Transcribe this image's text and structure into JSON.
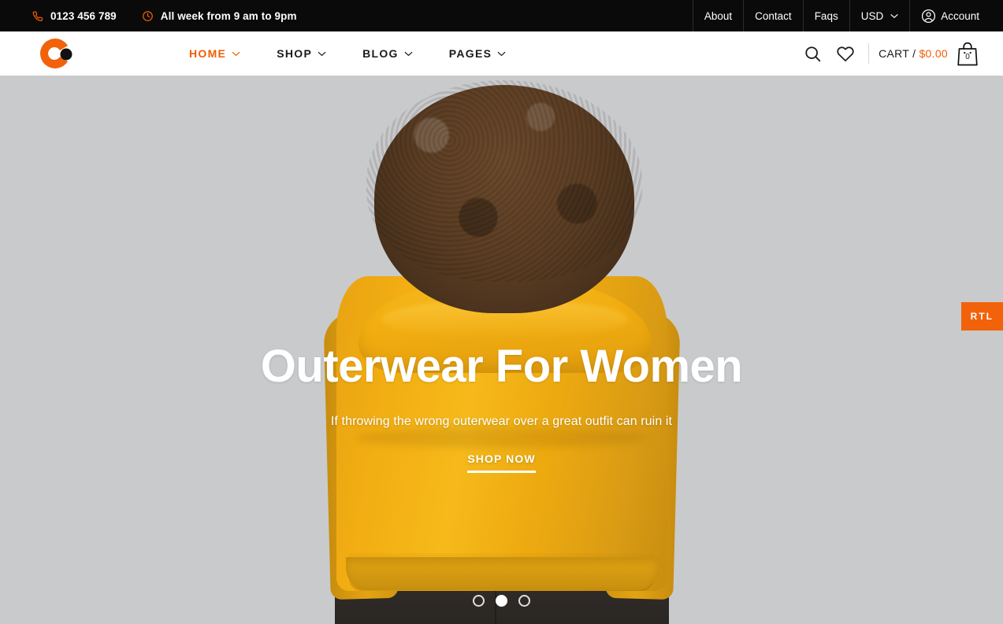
{
  "topbar": {
    "phone": "0123 456 789",
    "phone_icon": "phone-icon",
    "hours": "All week from 9 am to 9pm",
    "hours_icon": "clock-icon",
    "links": [
      "About",
      "Contact",
      "Faqs"
    ],
    "currency": "USD",
    "currency_chevron": "chevron-down-icon",
    "account": "Account",
    "account_icon": "user-circle-icon",
    "bg_color": "#0a0a0a",
    "accent_color": "#f25c05"
  },
  "nav": {
    "logo_name": "brand-logo",
    "menu": [
      {
        "label": "HOME",
        "active": true,
        "chevron": "chevron-down-icon"
      },
      {
        "label": "SHOP",
        "active": false,
        "chevron": "chevron-down-icon"
      },
      {
        "label": "BLOG",
        "active": false,
        "chevron": "chevron-down-icon"
      },
      {
        "label": "PAGES",
        "active": false,
        "chevron": "chevron-down-icon"
      }
    ],
    "search_icon": "search-icon",
    "wishlist_icon": "heart-icon",
    "cart_label": "CART / ",
    "cart_price": "$0.00",
    "cart_count": "0",
    "cart_icon": "shopping-bag-icon",
    "accent_color": "#f25c05",
    "text_color": "#1b1b1b"
  },
  "hero": {
    "title": "Outerwear For Women",
    "subtitle": "If throwing the wrong outerwear over a great outfit can ruin it",
    "cta": "SHOP NOW",
    "background_color": "#c9cacc",
    "jacket_color": "#f0ab12",
    "slides": [
      {
        "index": 1,
        "active": false
      },
      {
        "index": 2,
        "active": true
      },
      {
        "index": 3,
        "active": false
      }
    ]
  },
  "rtl_tab": {
    "label": "RTL",
    "color": "#f2620a"
  }
}
